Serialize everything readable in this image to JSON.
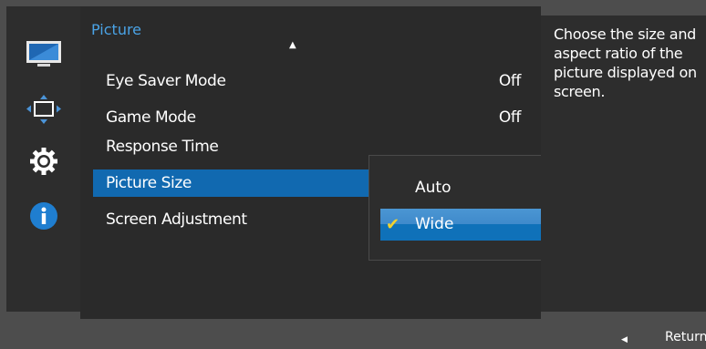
{
  "sidebar": {
    "items": [
      {
        "name": "picture-menu-icon"
      },
      {
        "name": "position-icon"
      },
      {
        "name": "system-gear-icon"
      },
      {
        "name": "information-icon"
      }
    ]
  },
  "menu": {
    "title": "Picture",
    "items": [
      {
        "label": "Eye Saver Mode",
        "value": "Off"
      },
      {
        "label": "Game Mode",
        "value": "Off"
      },
      {
        "label": "Response Time",
        "value": ""
      },
      {
        "label": "Picture Size",
        "value": ""
      },
      {
        "label": "Screen Adjustment",
        "value": ""
      }
    ],
    "selected_index": 3
  },
  "submenu": {
    "items": [
      {
        "label": "Auto",
        "checked": false
      },
      {
        "label": "Wide",
        "checked": true
      }
    ]
  },
  "help": {
    "text": "Choose the size and aspect ratio of the picture displayed on screen."
  },
  "footer": {
    "return_label": "Return"
  },
  "colors": {
    "accent": "#4aa3e6",
    "selection": "#1169b0",
    "check": "#f2d22e"
  }
}
